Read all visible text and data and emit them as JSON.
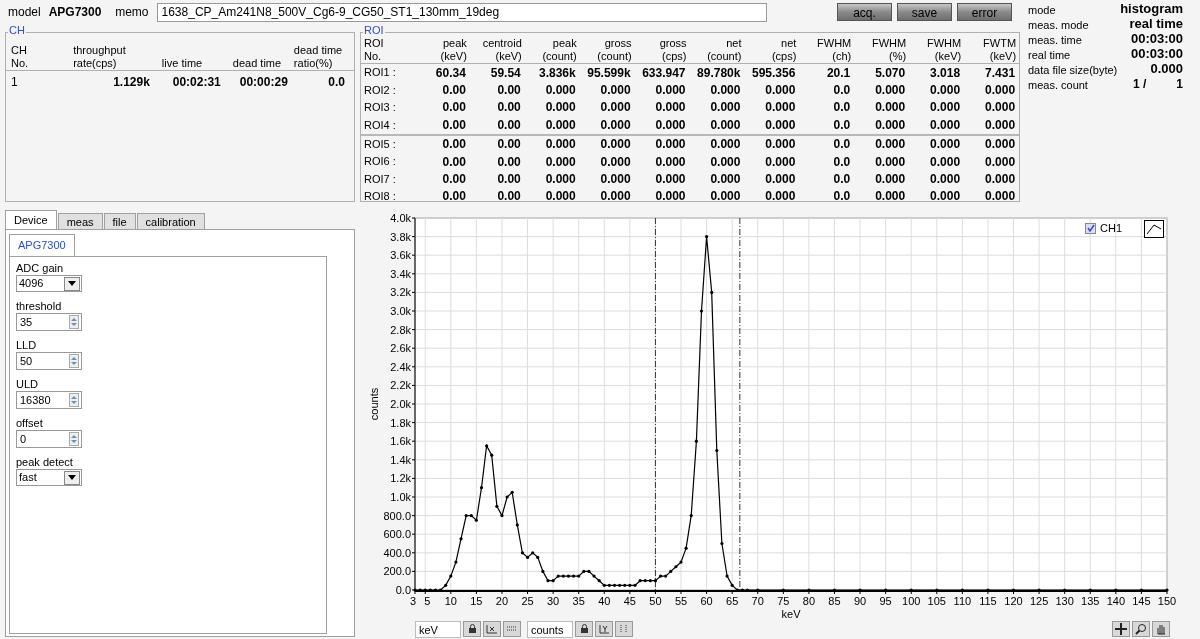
{
  "header": {
    "model_label": "model",
    "model": "APG7300",
    "memo_label": "memo",
    "memo": "1638_CP_Am241N8_500V_Cg6-9_CG50_ST1_130mm_19deg",
    "buttons": [
      "acq.",
      "save",
      "error"
    ]
  },
  "info": [
    {
      "label": "mode",
      "value": "histogram"
    },
    {
      "label": "meas. mode",
      "value": "real time"
    },
    {
      "label": "meas. time",
      "value": "00:03:00"
    },
    {
      "label": "real time",
      "value": "00:03:00"
    },
    {
      "label": "data file size(byte)",
      "value": "0.000"
    },
    {
      "label": "meas. count",
      "value": "1 /",
      "value_2": "1"
    }
  ],
  "ch": {
    "title": "CH",
    "columns": [
      "CH\nNo.",
      "throughput\nrate(cps)",
      "live time",
      "dead time",
      "dead time\nratio(%)"
    ],
    "rows": [
      [
        "1",
        "1.129k",
        "00:02:31",
        "00:00:29",
        "0.0"
      ]
    ]
  },
  "roi": {
    "title": "ROI",
    "columns": [
      "ROI\nNo.",
      "peak\n(keV)",
      "centroid\n(keV)",
      "peak\n(count)",
      "gross\n(count)",
      "gross\n(cps)",
      "net\n(count)",
      "net\n(cps)",
      "FWHM\n(ch)",
      "FWHM\n(%)",
      "FWHM\n(keV)",
      "FWTM\n(keV)"
    ],
    "groups": [
      [
        [
          "ROI1 :",
          "60.34",
          "59.54",
          "3.836k",
          "95.599k",
          "633.947",
          "89.780k",
          "595.356",
          "20.1",
          "5.070",
          "3.018",
          "7.431"
        ],
        [
          "ROI2 :",
          "0.00",
          "0.00",
          "0.000",
          "0.000",
          "0.000",
          "0.000",
          "0.000",
          "0.0",
          "0.000",
          "0.000",
          "0.000"
        ],
        [
          "ROI3 :",
          "0.00",
          "0.00",
          "0.000",
          "0.000",
          "0.000",
          "0.000",
          "0.000",
          "0.0",
          "0.000",
          "0.000",
          "0.000"
        ],
        [
          "ROI4 :",
          "0.00",
          "0.00",
          "0.000",
          "0.000",
          "0.000",
          "0.000",
          "0.000",
          "0.0",
          "0.000",
          "0.000",
          "0.000"
        ]
      ],
      [
        [
          "ROI5 :",
          "0.00",
          "0.00",
          "0.000",
          "0.000",
          "0.000",
          "0.000",
          "0.000",
          "0.0",
          "0.000",
          "0.000",
          "0.000"
        ],
        [
          "ROI6 :",
          "0.00",
          "0.00",
          "0.000",
          "0.000",
          "0.000",
          "0.000",
          "0.000",
          "0.0",
          "0.000",
          "0.000",
          "0.000"
        ],
        [
          "ROI7 :",
          "0.00",
          "0.00",
          "0.000",
          "0.000",
          "0.000",
          "0.000",
          "0.000",
          "0.0",
          "0.000",
          "0.000",
          "0.000"
        ],
        [
          "ROI8 :",
          "0.00",
          "0.00",
          "0.000",
          "0.000",
          "0.000",
          "0.000",
          "0.000",
          "0.0",
          "0.000",
          "0.000",
          "0.000"
        ]
      ]
    ]
  },
  "tabs": [
    {
      "label": "Device",
      "selected": true
    },
    {
      "label": "meas",
      "selected": false
    },
    {
      "label": "file",
      "selected": false
    },
    {
      "label": "calibration",
      "selected": false
    }
  ],
  "subtabs": [
    {
      "label": "APG7300",
      "selected": true
    }
  ],
  "settings": [
    {
      "label": "ADC gain",
      "kind": "dropdown",
      "value": "4096"
    },
    {
      "label": "threshold",
      "kind": "spinner",
      "value": "35"
    },
    {
      "label": "LLD",
      "kind": "spinner",
      "value": "50"
    },
    {
      "label": "ULD",
      "kind": "spinner",
      "value": "16380"
    },
    {
      "label": "offset",
      "kind": "spinner",
      "value": "0"
    },
    {
      "label": "peak detect",
      "kind": "dropdown",
      "value": "fast"
    }
  ],
  "plot": {
    "legend": {
      "checked": true
    },
    "x_axis_field": "keV",
    "y_axis_field": "counts",
    "chart_data": {
      "type": "line",
      "grid": true,
      "xlabel": "keV",
      "ylabel": "counts",
      "xlim": [
        3,
        150
      ],
      "ylim": [
        0,
        4000
      ],
      "xticks": [
        3,
        5,
        10,
        15,
        20,
        25,
        30,
        35,
        40,
        45,
        50,
        55,
        60,
        65,
        70,
        75,
        80,
        85,
        90,
        95,
        100,
        105,
        110,
        115,
        120,
        125,
        130,
        135,
        140,
        145,
        150
      ],
      "yticks": [
        {
          "value": 0,
          "label": "0.0"
        },
        {
          "value": 200,
          "label": "200.0"
        },
        {
          "value": 400,
          "label": "400.0"
        },
        {
          "value": 600,
          "label": "600.0"
        },
        {
          "value": 800,
          "label": "800.0"
        },
        {
          "value": 1000,
          "label": "1.0k"
        },
        {
          "value": 1200,
          "label": "1.2k"
        },
        {
          "value": 1400,
          "label": "1.4k"
        },
        {
          "value": 1600,
          "label": "1.6k"
        },
        {
          "value": 1800,
          "label": "1.8k"
        },
        {
          "value": 2000,
          "label": "2.0k"
        },
        {
          "value": 2200,
          "label": "2.2k"
        },
        {
          "value": 2400,
          "label": "2.4k"
        },
        {
          "value": 2600,
          "label": "2.6k"
        },
        {
          "value": 2800,
          "label": "2.8k"
        },
        {
          "value": 3000,
          "label": "3.0k"
        },
        {
          "value": 3200,
          "label": "3.2k"
        },
        {
          "value": 3400,
          "label": "3.4k"
        },
        {
          "value": 3600,
          "label": "3.6k"
        },
        {
          "value": 3800,
          "label": "3.8k"
        },
        {
          "value": 4000,
          "label": "4.0k"
        }
      ],
      "x": [
        3,
        4,
        5,
        6,
        7,
        8,
        9,
        10,
        11,
        12,
        13,
        14,
        15,
        16,
        17,
        18,
        19,
        20,
        21,
        22,
        23,
        24,
        25,
        26,
        27,
        28,
        29,
        30,
        31,
        32,
        33,
        34,
        35,
        36,
        37,
        38,
        39,
        40,
        41,
        42,
        43,
        44,
        45,
        46,
        47,
        48,
        49,
        50,
        51,
        52,
        53,
        54,
        55,
        56,
        57,
        58,
        59,
        60,
        61,
        62,
        63,
        64,
        65,
        66,
        67,
        68,
        70,
        75,
        80,
        85,
        90,
        95,
        100,
        105,
        110,
        115,
        120,
        125,
        130,
        135,
        140,
        145,
        150
      ],
      "series": [
        {
          "name": "CH1",
          "color": "#000000",
          "values": [
            0,
            0,
            0,
            0,
            0,
            0,
            50,
            150,
            300,
            550,
            800,
            800,
            750,
            1100,
            1550,
            1450,
            900,
            800,
            1000,
            1050,
            700,
            400,
            350,
            400,
            350,
            200,
            100,
            100,
            150,
            150,
            150,
            150,
            150,
            200,
            200,
            150,
            100,
            50,
            50,
            50,
            50,
            50,
            50,
            50,
            100,
            100,
            100,
            100,
            150,
            150,
            200,
            250,
            300,
            450,
            800,
            1600,
            3000,
            3800,
            3200,
            1500,
            500,
            150,
            50,
            0,
            0,
            0,
            0,
            0,
            0,
            0,
            0,
            0,
            0,
            0,
            0,
            0,
            0,
            0,
            0,
            0,
            0,
            0,
            0
          ]
        }
      ],
      "ref_lines": [
        {
          "axis": "x",
          "value": 50
        },
        {
          "axis": "x",
          "value": 66.5
        }
      ]
    }
  }
}
